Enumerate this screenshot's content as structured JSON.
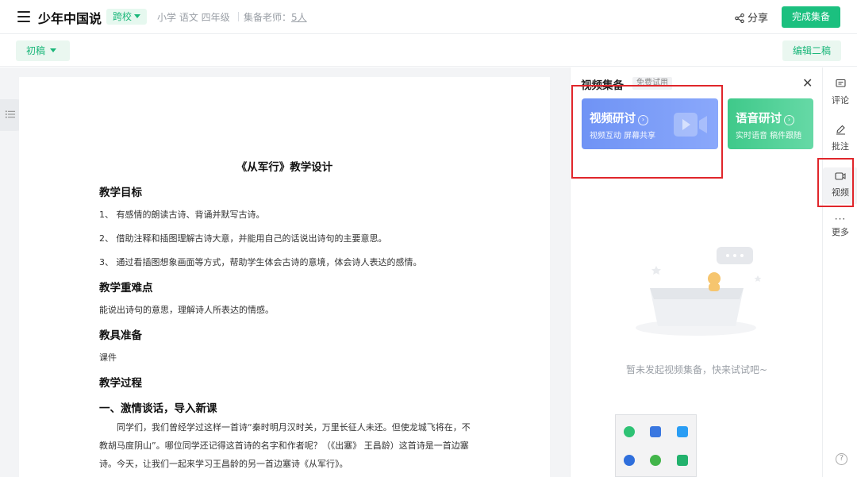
{
  "topbar": {
    "app_title": "少年中国说",
    "school_tag": "跨校",
    "subject_meta": "小学  语文  四年级",
    "teachers_label": "集备老师：",
    "teachers_count": "5人",
    "share_label": "分享",
    "finish_button": "完成集备"
  },
  "subbar": {
    "draft_label": "初稿",
    "edit_second_draft": "编辑二稿"
  },
  "document": {
    "title": "《从军行》教学设计",
    "goals_heading": "教学目标",
    "goal_1": "1、 有感情的朗读古诗、背诵并默写古诗。",
    "goal_2": "2、 借助注释和插图理解古诗大意，并能用自己的话说出诗句的主要意思。",
    "goal_3": "3、 通过看插图想象画面等方式，帮助学生体会古诗的意境，体会诗人表达的感情。",
    "key_points_heading": "教学重难点",
    "key_points_text": "能说出诗句的意思，理解诗人所表达的情感。",
    "tools_heading": "教具准备",
    "tools_text": "课件",
    "process_heading": "教学过程",
    "section_1_heading": "一、激情谈话，导入新课",
    "section_1_paragraph": "同学们，我们曾经学过这样一首诗“秦时明月汉时关，万里长征人未还。但使龙城飞将在，不教胡马度阴山”。哪位同学还记得这首诗的名字和作者呢？（《出塞》  王昌龄）这首诗是一首边塞诗。今天，让我们一起来学习王昌龄的另一首边塞诗《从军行》。"
  },
  "video_panel": {
    "title": "视频集备",
    "trial_badge": "免费试用",
    "video_card": {
      "title": "视频研讨",
      "subtitle": "视频互动  屏幕共享",
      "color": "#7b9cf7"
    },
    "voice_card": {
      "title": "语音研讨",
      "subtitle": "实时语音  稿件跟随",
      "color": "#4ccf93"
    },
    "empty_text": "暂未发起视频集备，快来试试吧~"
  },
  "rail": {
    "comment": "评论",
    "annotate": "批注",
    "video": "视频",
    "more": "更多",
    "help": "?"
  },
  "colors": {
    "accent": "#1bc07f",
    "highlight_box": "#e0262b"
  }
}
